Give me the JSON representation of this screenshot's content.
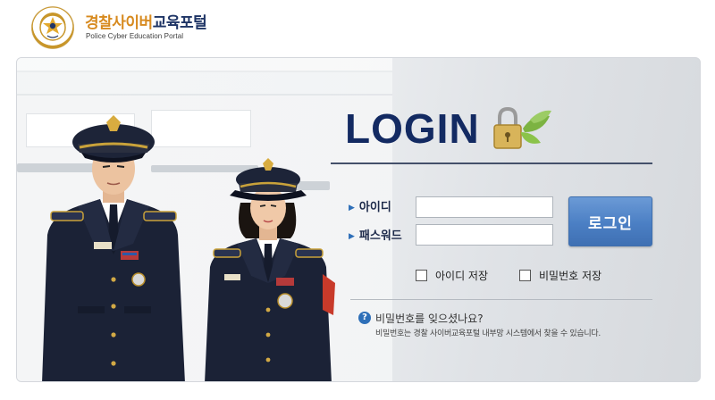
{
  "header": {
    "title_part1": "경찰사이버",
    "title_part2": "교육포털",
    "subtitle": "Police Cyber Education Portal"
  },
  "login": {
    "title": "LOGIN",
    "id_label": "아이디",
    "password_label": "패스워드",
    "id_value": "",
    "password_value": "",
    "button_label": "로그인",
    "save_id_label": "아이디 저장",
    "save_password_label": "비밀번호 저장"
  },
  "help": {
    "question": "비밀번호를 잊으셨나요?",
    "description": "비밀번호는 경찰 사이버교육포털 내부망 시스템에서 찾을 수 있습니다."
  },
  "icons": {
    "lock": "padlock-with-leaves-icon",
    "help": "question-circle-icon",
    "arrow": "triangle-right-icon",
    "emblem": "police-emblem-icon"
  },
  "colors": {
    "title_navy": "#132a62",
    "brand_orange": "#d78a1f",
    "button_blue": "#4b7fc4"
  }
}
